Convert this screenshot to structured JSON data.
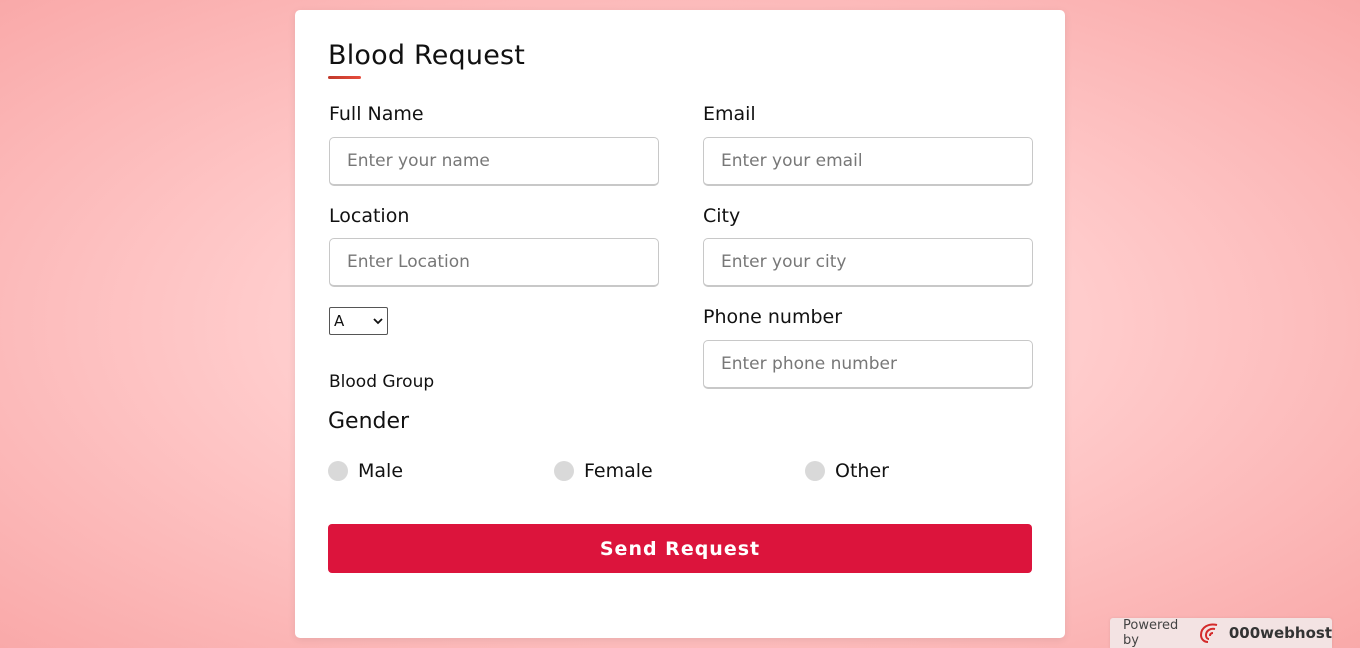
{
  "form": {
    "title": "Blood Request",
    "full_name": {
      "label": "Full Name",
      "placeholder": "Enter your name"
    },
    "email": {
      "label": "Email",
      "placeholder": "Enter your email"
    },
    "location": {
      "label": "Location",
      "placeholder": "Enter Location"
    },
    "city": {
      "label": "City",
      "placeholder": "Enter your city"
    },
    "phone": {
      "label": "Phone number",
      "placeholder": "Enter phone number"
    },
    "blood_group": {
      "selected": "A",
      "label": "Blood Group"
    },
    "gender": {
      "title": "Gender",
      "options": [
        "Male",
        "Female",
        "Other"
      ]
    },
    "submit_label": "Send Request"
  },
  "footer": {
    "powered_by": "Powered by",
    "brand": "000webhost"
  },
  "colors": {
    "accent": "#dc143c",
    "radio": "#d9d9d9"
  }
}
